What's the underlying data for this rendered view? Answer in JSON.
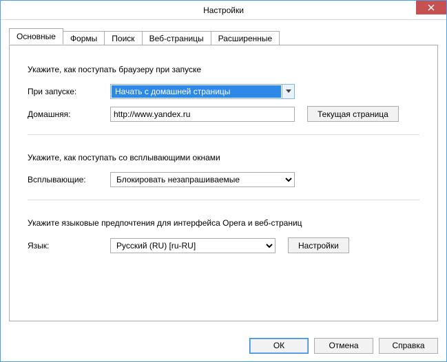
{
  "window": {
    "title": "Настройки"
  },
  "tabs": {
    "t0": "Основные",
    "t1": "Формы",
    "t2": "Поиск",
    "t3": "Веб-страницы",
    "t4": "Расширенные"
  },
  "startup": {
    "desc": "Укажите, как поступать браузеру при запуске",
    "on_startup_label": "При запуске:",
    "on_startup_value": "Начать с домашней страницы",
    "home_label": "Домашняя:",
    "home_value": "http://www.yandex.ru",
    "current_page_btn": "Текущая страница"
  },
  "popups": {
    "desc": "Укажите, как поступать со всплывающими окнами",
    "label": "Всплывающие:",
    "value": "Блокировать незапрашиваемые"
  },
  "language": {
    "desc": "Укажите языковые предпочтения для интерфейса Opera и веб-страниц",
    "label": "Язык:",
    "value": "Русский (RU) [ru-RU]",
    "settings_btn": "Настройки"
  },
  "footer": {
    "ok": "ОК",
    "cancel": "Отмена",
    "help": "Справка"
  }
}
